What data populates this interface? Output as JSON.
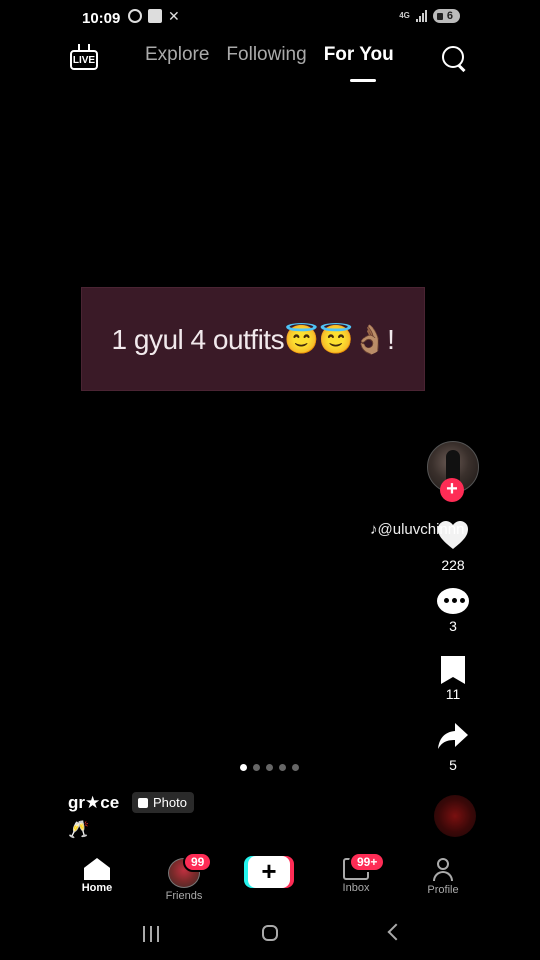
{
  "status_bar": {
    "time": "10:09",
    "network": "4G",
    "battery": "6"
  },
  "top_nav": {
    "live_label": "LIVE",
    "tabs": [
      {
        "label": "Explore"
      },
      {
        "label": "Following"
      },
      {
        "label": "For You"
      }
    ],
    "active_tab": "For You"
  },
  "post": {
    "caption_overlay": "1 gyul 4 outfits😇😇👌🏽!",
    "tiktok_handle": "@uluvchinnn",
    "likes": "228",
    "comments": "3",
    "saves": "11",
    "shares": "5",
    "slide_count": 5,
    "current_slide": 1,
    "username": "gr★ce",
    "type_badge": "Photo",
    "caption": "🥂"
  },
  "bottom_nav": {
    "items": [
      {
        "label": "Home"
      },
      {
        "label": "Friends",
        "badge": "99"
      },
      {
        "label": "Create"
      },
      {
        "label": "Inbox",
        "badge": "99+"
      },
      {
        "label": "Profile"
      }
    ]
  },
  "colors": {
    "accent": "#fe2c55",
    "cyan": "#25f4ee",
    "banner_bg": "#3a1a27"
  }
}
